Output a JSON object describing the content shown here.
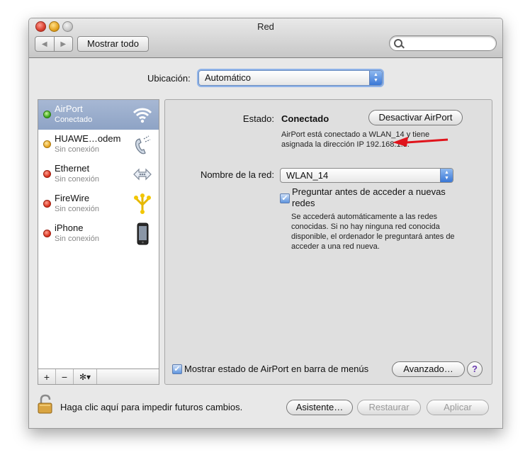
{
  "window": {
    "title": "Red"
  },
  "toolbar": {
    "show_all": "Mostrar todo",
    "search_placeholder": ""
  },
  "location": {
    "label": "Ubicación:",
    "value": "Automático"
  },
  "services": [
    {
      "name": "AirPort",
      "status": "Conectado",
      "dot": "green",
      "icon": "wifi-icon"
    },
    {
      "name": "HUAWE…odem",
      "status": "Sin conexión",
      "dot": "yellow",
      "icon": "phone-modem-icon"
    },
    {
      "name": "Ethernet",
      "status": "Sin conexión",
      "dot": "red",
      "icon": "ethernet-icon"
    },
    {
      "name": "FireWire",
      "status": "Sin conexión",
      "dot": "red",
      "icon": "firewire-icon"
    },
    {
      "name": "iPhone",
      "status": "Sin conexión",
      "dot": "red",
      "icon": "iphone-icon"
    }
  ],
  "sidebar_footer": {
    "add": "+",
    "remove": "−",
    "gear": "✻▾"
  },
  "detail": {
    "status_label": "Estado:",
    "status_value": "Conectado",
    "toggle_button": "Desactivar AirPort",
    "status_desc_1": "AirPort está conectado a WLAN_14 y tiene",
    "status_desc_2": "asignada la dirección IP 192.168.1.3.",
    "network_label": "Nombre de la red:",
    "network_value": "WLAN_14",
    "ask_label_1": "Preguntar antes de acceder a nuevas",
    "ask_label_2": "redes",
    "ask_note": "Se accederá automáticamente a las redes conocidas. Si no hay ninguna red conocida disponible, el ordenador le preguntará antes de acceder a una red nueva.",
    "show_status_label": "Mostrar estado de AirPort en barra de menús",
    "advanced_button": "Avanzado…",
    "help": "?"
  },
  "bottom": {
    "lock_text": "Haga clic aquí para impedir futuros cambios.",
    "assistant": "Asistente…",
    "revert": "Restaurar",
    "apply": "Aplicar"
  },
  "colors": {
    "selection": "#8ea3c5",
    "annotation_arrow": "#e0141c"
  }
}
